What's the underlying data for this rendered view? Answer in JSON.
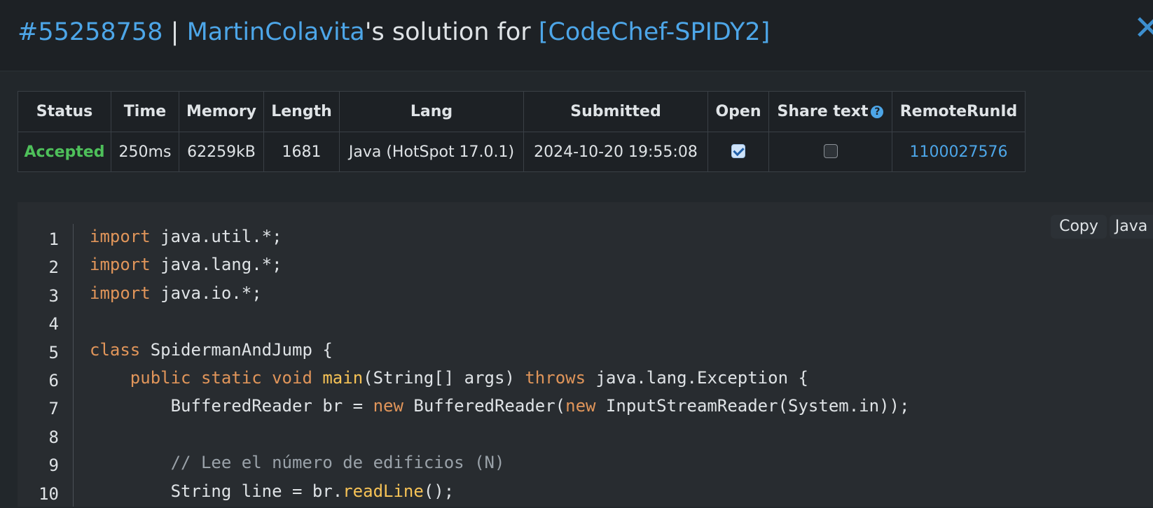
{
  "header": {
    "submission_id": "#55258758",
    "separator": "|",
    "user": "MartinColavita",
    "solution_for": "'s solution for",
    "problem": "[CodeChef-SPIDY2]",
    "close_icon": "close-icon"
  },
  "table": {
    "headers": {
      "status": "Status",
      "time": "Time",
      "memory": "Memory",
      "length": "Length",
      "lang": "Lang",
      "submitted": "Submitted",
      "open": "Open",
      "share_text": "Share text",
      "help": "?",
      "remote_run_id": "RemoteRunId"
    },
    "row": {
      "status": "Accepted",
      "time": "250ms",
      "memory": "62259kB",
      "length": "1681",
      "lang": "Java (HotSpot 17.0.1)",
      "submitted": "2024-10-20 19:55:08",
      "open_checked": true,
      "share_checked": false,
      "remote_run_id": "1100027576"
    },
    "colors": {
      "accepted": "#4ec05a",
      "link": "#4da6e8"
    }
  },
  "code_panel": {
    "copy_label": "Copy",
    "language_label": "Java",
    "lines": [
      {
        "n": "1",
        "tokens": [
          {
            "t": "import",
            "c": "kw"
          },
          {
            "t": " java.util.*;"
          }
        ]
      },
      {
        "n": "2",
        "tokens": [
          {
            "t": "import",
            "c": "kw"
          },
          {
            "t": " java.lang.*;"
          }
        ]
      },
      {
        "n": "3",
        "tokens": [
          {
            "t": "import",
            "c": "kw"
          },
          {
            "t": " java.io.*;"
          }
        ]
      },
      {
        "n": "4",
        "tokens": []
      },
      {
        "n": "5",
        "tokens": [
          {
            "t": "class",
            "c": "kw"
          },
          {
            "t": " SpidermanAndJump {"
          }
        ]
      },
      {
        "n": "6",
        "tokens": [
          {
            "t": "    "
          },
          {
            "t": "public",
            "c": "kw"
          },
          {
            "t": " "
          },
          {
            "t": "static",
            "c": "kw"
          },
          {
            "t": " "
          },
          {
            "t": "void",
            "c": "kw"
          },
          {
            "t": " "
          },
          {
            "t": "main",
            "c": "fn"
          },
          {
            "t": "(String[] args) "
          },
          {
            "t": "throws",
            "c": "kw"
          },
          {
            "t": " java.lang.Exception {"
          }
        ]
      },
      {
        "n": "7",
        "tokens": [
          {
            "t": "        BufferedReader br = "
          },
          {
            "t": "new",
            "c": "kw"
          },
          {
            "t": " BufferedReader("
          },
          {
            "t": "new",
            "c": "kw"
          },
          {
            "t": " InputStreamReader(System.in));"
          }
        ]
      },
      {
        "n": "8",
        "tokens": []
      },
      {
        "n": "9",
        "tokens": [
          {
            "t": "        "
          },
          {
            "t": "// Lee el número de edificios (N)",
            "c": "cm"
          }
        ]
      },
      {
        "n": "10",
        "tokens": [
          {
            "t": "        String line = br."
          },
          {
            "t": "readLine",
            "c": "fn"
          },
          {
            "t": "();"
          }
        ]
      }
    ]
  }
}
